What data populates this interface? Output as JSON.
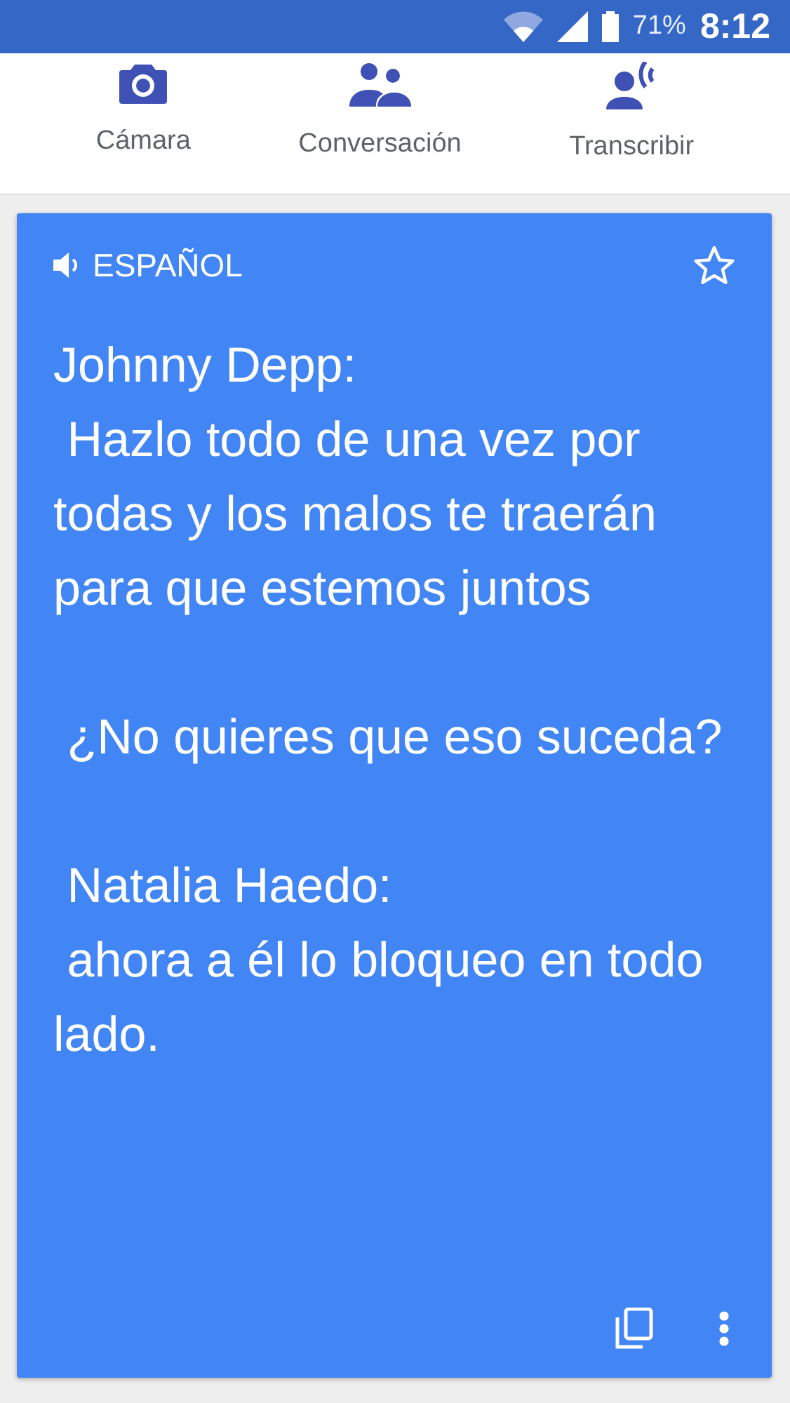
{
  "status_bar": {
    "battery": "71%",
    "time": "8:12"
  },
  "modes": [
    {
      "kind": "camera",
      "label": "Cámara"
    },
    {
      "kind": "conversation",
      "label": "Conversación"
    },
    {
      "kind": "transcribe",
      "label": "Transcribir"
    }
  ],
  "card": {
    "language": "ESPAÑOL",
    "starred": false,
    "text": "Johnny Depp:\n Hazlo todo de una vez por todas y los malos te traerán para que estemos juntos\n\n ¿No quieres que eso suceda?\n\n Natalia Haedo:\n ahora a él lo bloqueo en todo lado."
  }
}
